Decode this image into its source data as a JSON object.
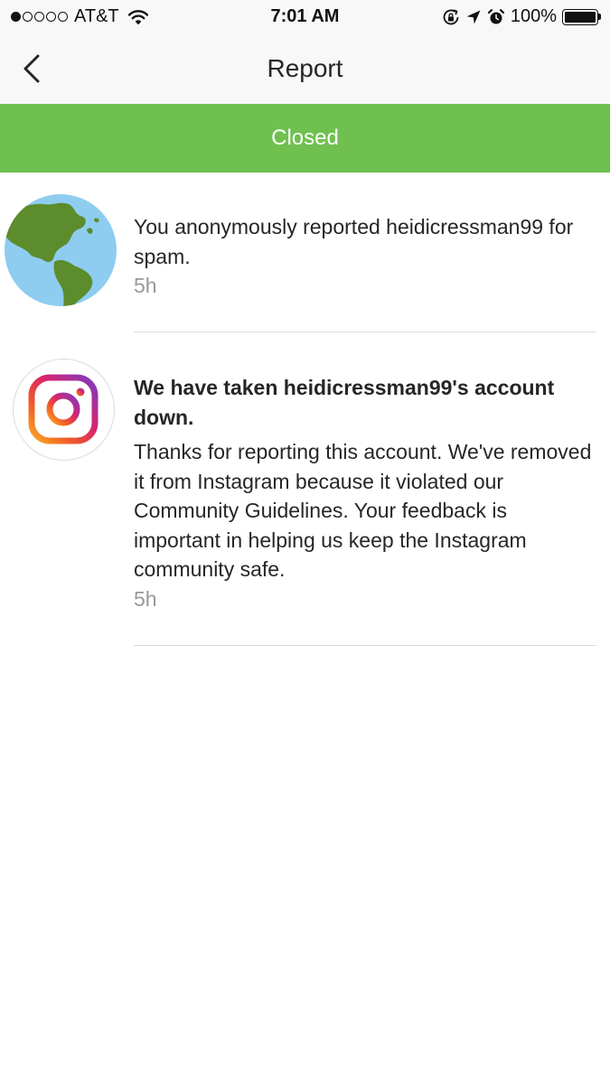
{
  "status_bar": {
    "carrier": "AT&T",
    "time": "7:01 AM",
    "battery": "100%",
    "signal_bars_filled": 1,
    "signal_bars_total": 5
  },
  "nav": {
    "title": "Report",
    "back_icon": "chevron-left-icon"
  },
  "banner": {
    "label": "Closed",
    "color": "#70c050"
  },
  "items": [
    {
      "avatar_icon": "globe-icon",
      "text": "You anonymously reported heidicressman99 for spam.",
      "time": "5h"
    },
    {
      "avatar_icon": "instagram-logo-icon",
      "headline": "We have taken heidicressman99's account down.",
      "text": "Thanks for reporting this account. We've removed it from Instagram because it violated our Community Guidelines. Your feedback is important in helping us keep the Instagram community safe.",
      "time": "5h"
    }
  ]
}
